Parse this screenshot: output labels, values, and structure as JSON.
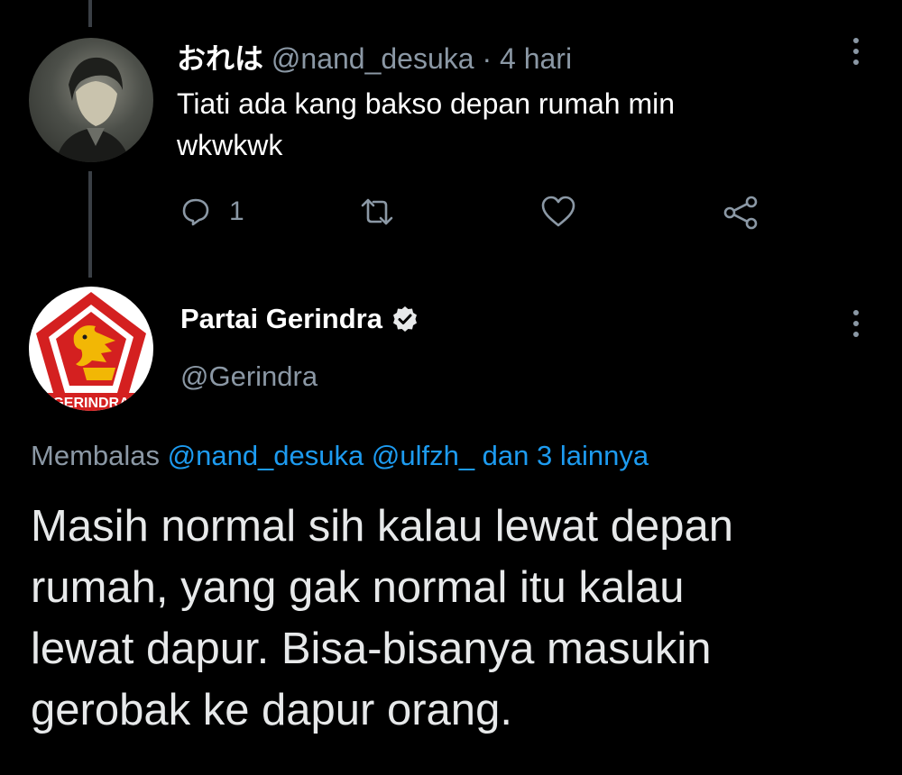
{
  "reply_tweet": {
    "display_name": "おれは",
    "handle": "@nand_desuka",
    "separator": "·",
    "time": "4 hari",
    "text_line1": "Tiati ada kang bakso depan rumah min",
    "text_line2": "wkwkwk",
    "reply_count": "1",
    "icons": [
      "reply-icon",
      "retweet-icon",
      "like-icon",
      "share-icon",
      "more-icon"
    ]
  },
  "main_tweet": {
    "display_name": "Partai Gerindra",
    "handle": "@Gerindra",
    "verified": true,
    "avatar_text": "GERINDRA",
    "replying_prefix": "Membalas",
    "replying_mentions": "@nand_desuka @ulfzh_ dan 3 lainnya",
    "body_lines": [
      "Masih normal sih kalau lewat depan",
      "rumah, yang gak normal itu kalau",
      "lewat dapur. Bisa-bisanya masukin",
      "gerobak ke dapur orang."
    ]
  },
  "colors": {
    "background": "#000000",
    "muted": "#8b98a5",
    "link": "#1d9bf0",
    "gerindra_red": "#d42020",
    "gerindra_gold": "#f2b705"
  }
}
